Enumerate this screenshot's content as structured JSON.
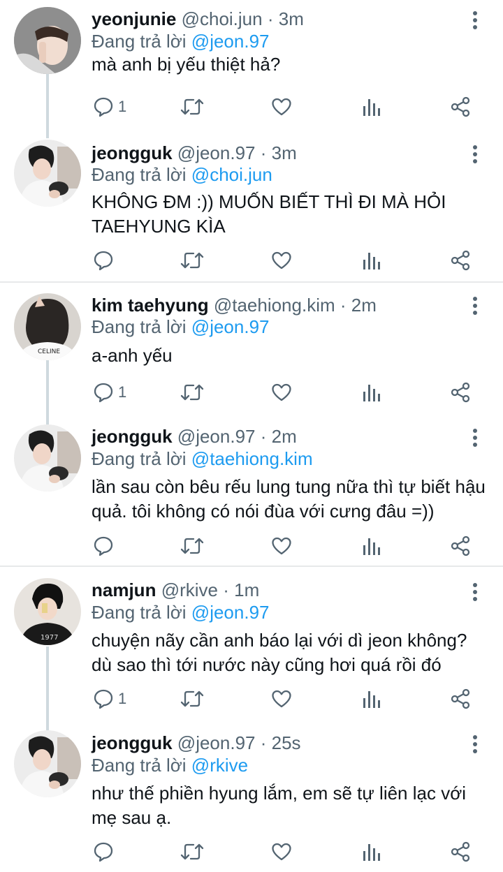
{
  "replying_label": "Đang trả lời",
  "tweets": [
    {
      "name": "yeonjunie",
      "handle": "@choi.jun",
      "sep": "·",
      "time": "3m",
      "replying_to": "@jeon.97",
      "text": "mà anh bị yếu thiệt hả?",
      "reply_count": "1"
    },
    {
      "name": "jeongguk",
      "handle": "@jeon.97",
      "sep": "·",
      "time": "3m",
      "replying_to": "@choi.jun",
      "text": "KHÔNG ĐM :)) MUỐN BIẾT THÌ ĐI MÀ HỎI TAEHYUNG KÌA",
      "reply_count": ""
    },
    {
      "name": "kim taehyung",
      "handle": "@taehiong.kim",
      "sep": "·",
      "time": "2m",
      "replying_to": "@jeon.97",
      "text": "a-anh yếu",
      "reply_count": "1"
    },
    {
      "name": "jeongguk",
      "handle": "@jeon.97",
      "sep": "·",
      "time": "2m",
      "replying_to": "@taehiong.kim",
      "text": "lần sau còn bêu rếu lung tung nữa thì tự biết hậu quả. tôi không có nói đùa với cưng đâu =))",
      "reply_count": ""
    },
    {
      "name": "namjun",
      "handle": "@rkive",
      "sep": "·",
      "time": "1m",
      "replying_to": "@jeon.97",
      "text": "chuyện nãy cần anh báo lại với dì jeon không? dù sao thì tới nước này cũng hơi quá rồi đó",
      "reply_count": "1"
    },
    {
      "name": "jeongguk",
      "handle": "@jeon.97",
      "sep": "·",
      "time": "25s",
      "replying_to": "@rkive",
      "text": "như thế phiền hyung lắm, em sẽ tự liên lạc với mẹ sau ạ.",
      "reply_count": ""
    }
  ],
  "icons": {
    "reply": "reply-icon",
    "retweet": "retweet-icon",
    "like": "heart-icon",
    "views": "views-icon",
    "share": "share-icon",
    "more": "more-vertical-icon"
  },
  "colors": {
    "text": "#0f1419",
    "muted": "#536471",
    "mention": "#1d9bf0",
    "divider": "#e7e9ea",
    "thread_line": "#cfd9de"
  }
}
